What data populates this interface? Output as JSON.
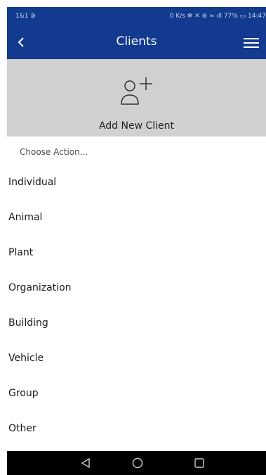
{
  "status_bar": {
    "left_text": "1&1 ⋑",
    "right_text": "0 K/s ✻ ✕ ⊛ ≈ ıll 77% ▭ 14:47"
  },
  "app_bar": {
    "title": "Clients",
    "back_icon": "chevron-left-icon",
    "menu_icon": "hamburger-menu-icon"
  },
  "add_client": {
    "label": "Add New Client",
    "icon": "add-person-icon"
  },
  "action_sheet": {
    "prompt": "Choose Action...",
    "options": [
      "Individual",
      "Animal",
      "Plant",
      "Organization",
      "Building",
      "Vehicle",
      "Group",
      "Other"
    ]
  },
  "nav_bar": {
    "back_icon": "triangle-back-icon",
    "home_icon": "circle-home-icon",
    "recents_icon": "square-recents-icon"
  },
  "colors": {
    "primary": "#123a8e",
    "panel": "#d0d0d0",
    "nav": "#000000"
  }
}
